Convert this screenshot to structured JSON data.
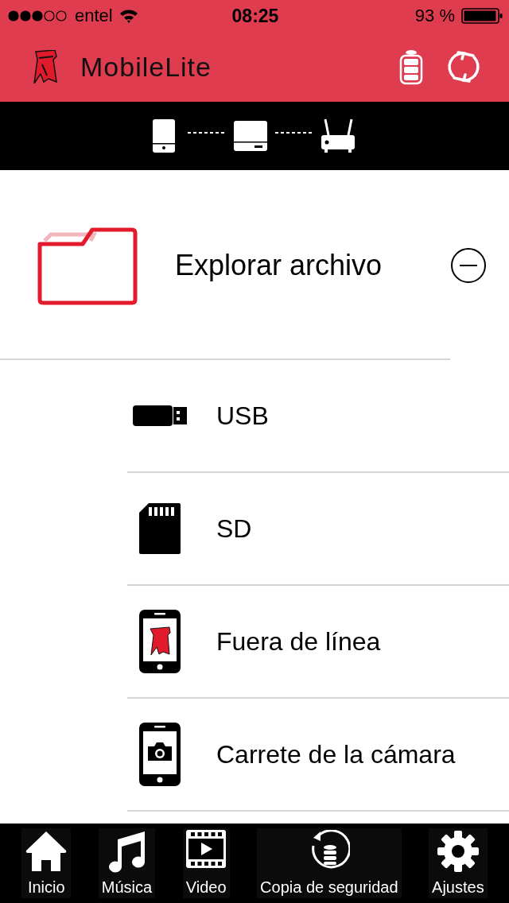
{
  "status_bar": {
    "carrier": "entel",
    "time": "08:25",
    "battery": "93 %"
  },
  "app_bar": {
    "title": "MobileLite"
  },
  "section": {
    "title": "Explorar archivo",
    "expanded": true
  },
  "items": [
    {
      "kind": "usb",
      "label": "USB"
    },
    {
      "kind": "sd",
      "label": "SD"
    },
    {
      "kind": "offline",
      "label": "Fuera de línea"
    },
    {
      "kind": "camera",
      "label": "Carrete de la cámara"
    }
  ],
  "tabs": [
    {
      "kind": "home",
      "label": "Inicio"
    },
    {
      "kind": "music",
      "label": "Música"
    },
    {
      "kind": "video",
      "label": "Video"
    },
    {
      "kind": "backup",
      "label": "Copia de seguridad"
    },
    {
      "kind": "settings",
      "label": "Ajustes"
    }
  ]
}
